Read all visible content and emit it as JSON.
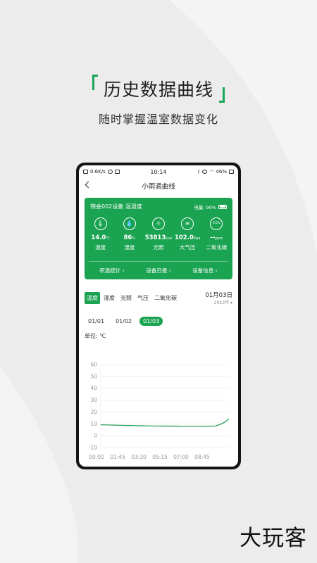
{
  "hero": {
    "title": "历史数据曲线",
    "subtitle": "随时掌握温室数据变化"
  },
  "status_bar": {
    "speed": "0.6K/s",
    "time": "10:14",
    "battery": "46%"
  },
  "nav": {
    "title": "小雨滴曲线"
  },
  "card": {
    "device": "锦会002设备 温湿度",
    "battery_label": "电量: 90%",
    "battery_level": 0.9,
    "metrics": [
      {
        "icon": "thermometer-icon",
        "glyph": "🌡",
        "value": "14.0",
        "unit": "℃",
        "label": "温度"
      },
      {
        "icon": "humidity-icon",
        "glyph": "💧",
        "value": "86",
        "unit": "%",
        "label": "湿度"
      },
      {
        "icon": "sun-icon",
        "glyph": "☼",
        "value": "53813",
        "unit": "Lux",
        "label": "光照"
      },
      {
        "icon": "pressure-icon",
        "glyph": "≋",
        "value": "102.0",
        "unit": "Kpa",
        "label": "大气压"
      },
      {
        "icon": "co2-icon",
        "glyph": "CO₂",
        "value": "--",
        "unit": "ppm",
        "label": "二氧化碳"
      }
    ],
    "links": [
      "积温统计 ›",
      "设备日报 ›",
      "设备信息 ›"
    ]
  },
  "tabs": [
    "温度",
    "湿度",
    "光照",
    "气压",
    "二氧化碳"
  ],
  "active_tab": 0,
  "date": {
    "main": "01月03日",
    "year": "2023年 ▾"
  },
  "days": [
    "01/01",
    "01/02",
    "01/03"
  ],
  "active_day": 2,
  "unit_label": "单位: ℃",
  "brand": "大玩客",
  "colors": {
    "accent": "#1aa351",
    "line": "#1a9a4c"
  },
  "chart_data": {
    "type": "line",
    "x": [
      "00:00",
      "01:45",
      "03:30",
      "05:15",
      "07:00",
      "08:45"
    ],
    "ylim": [
      -10,
      60
    ],
    "yticks": [
      60,
      50,
      40,
      30,
      20,
      10,
      0,
      -10
    ],
    "grid": true,
    "series": [
      {
        "values": [
          [
            0,
            9.2
          ],
          [
            0.5,
            9.1
          ],
          [
            1,
            8.9
          ],
          [
            1.5,
            8.8
          ],
          [
            2,
            8.6
          ],
          [
            2.5,
            8.5
          ],
          [
            3,
            8.4
          ],
          [
            3.5,
            8.3
          ],
          [
            4,
            8.2
          ],
          [
            4.5,
            8.2
          ],
          [
            5,
            8.1
          ],
          [
            5.5,
            8.1
          ],
          [
            6,
            8.0
          ],
          [
            6.5,
            8.0
          ],
          [
            7,
            8.0
          ],
          [
            7.5,
            8.0
          ],
          [
            8,
            8.1
          ],
          [
            8.5,
            8.2
          ],
          [
            8.85,
            9.5
          ],
          [
            9.2,
            11.5
          ],
          [
            9.5,
            14.0
          ]
        ]
      }
    ]
  }
}
